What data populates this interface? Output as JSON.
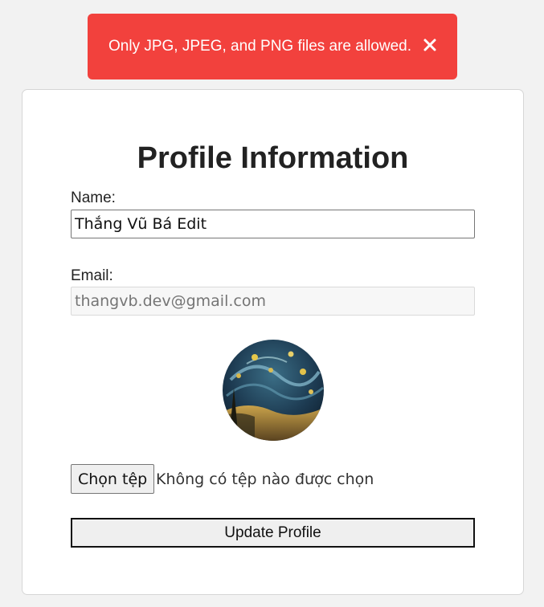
{
  "toast": {
    "message": "Only JPG, JPEG, and PNG files are allowed.",
    "close_icon": "close-icon",
    "background": "#f2413d"
  },
  "profile": {
    "title": "Profile Information",
    "name_label": "Name:",
    "name_value": "Thắng Vũ Bá Edit",
    "email_label": "Email:",
    "email_value": "thangvb.dev@gmail.com",
    "avatar_icon": "avatar-image",
    "file_button_label": "Chọn tệp",
    "file_status": "Không có tệp nào được chọn",
    "update_button_label": "Update Profile"
  }
}
